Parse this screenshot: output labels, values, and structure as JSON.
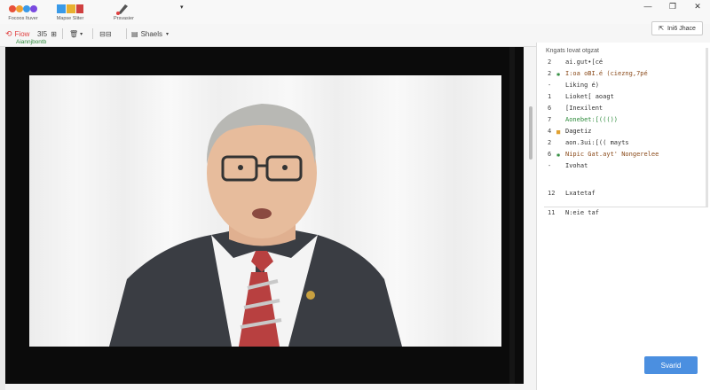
{
  "titlebar": {
    "groups": [
      {
        "label": "Focoos Ituver"
      },
      {
        "label": "Mapse Sliter"
      },
      {
        "label": "Prsvasier"
      }
    ],
    "window_controls": [
      "—",
      "❐",
      "✕"
    ]
  },
  "toolbar": {
    "flow_label": "Fiow",
    "num_label": "3I5",
    "sheets_label": "Shaels",
    "sub_label": "Aiannjbontb",
    "share_label": "Ini6 Jhace"
  },
  "panel": {
    "header": "Kngats Iovat otgzat",
    "lines": [
      {
        "num": "2",
        "icon": "",
        "text": "ai.gut•[cé",
        "color": "#333"
      },
      {
        "num": "2",
        "icon": "✱",
        "text": "I:oa oBI.é (ciezng,7pé",
        "color": "#8a4a1a"
      },
      {
        "num": "-",
        "icon": "",
        "text": "Liking é)",
        "color": "#333"
      },
      {
        "num": "1",
        "icon": "",
        "text": "Lioket[ aoagt",
        "color": "#333"
      },
      {
        "num": "6",
        "icon": "",
        "text": "[Inexilent",
        "color": "#333"
      },
      {
        "num": "7",
        "icon": "",
        "text": "Aonebet:[((())",
        "color": "#2c8a3a"
      },
      {
        "num": "4",
        "icon": "■",
        "text": "Dagetiz",
        "color": "#333"
      },
      {
        "num": "2",
        "icon": "",
        "text": "aon.3ui:[(( mayts",
        "color": "#333"
      },
      {
        "num": "6",
        "icon": "✱",
        "text": "Nipic Gat.ayt' Nongerelee",
        "color": "#8a4a1a"
      },
      {
        "num": "-",
        "icon": "",
        "text": "Ivohat",
        "color": "#333"
      },
      {
        "num": "12",
        "icon": "",
        "text": "Lxatetaf",
        "color": "#333"
      },
      {
        "num": "11",
        "icon": "",
        "text": "N:eie taf",
        "color": "#333"
      }
    ],
    "start_label": "Svarid"
  }
}
